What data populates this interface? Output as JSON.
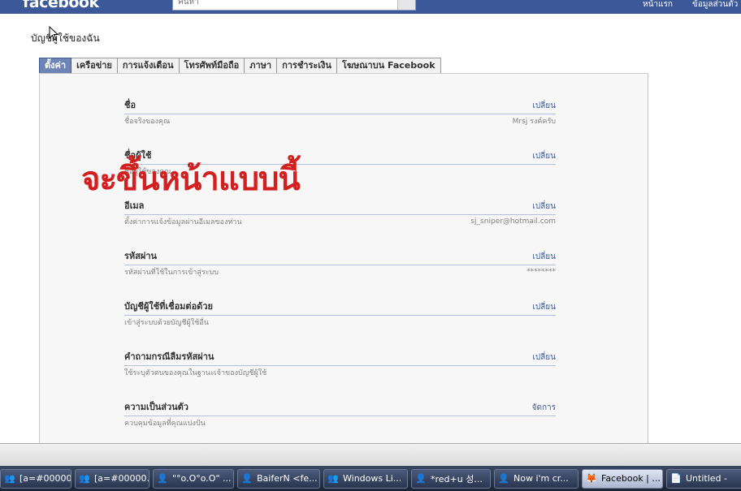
{
  "topbar": {
    "logo": "facebook",
    "search_placeholder": "ค้นหา",
    "links": [
      "หน้าแรก",
      "ข้อมูลส่วนตัว"
    ]
  },
  "page": {
    "title": "บัญชีผู้ใช้ของฉัน"
  },
  "tabs": [
    {
      "label": "ตั้งค่า",
      "active": true
    },
    {
      "label": "เครือข่าย",
      "active": false
    },
    {
      "label": "การแจ้งเตือน",
      "active": false
    },
    {
      "label": "โทรศัพท์มือถือ",
      "active": false
    },
    {
      "label": "ภาษา",
      "active": false
    },
    {
      "label": "การชำระเงิน",
      "active": false
    },
    {
      "label": "โฆษณาบน Facebook",
      "active": false
    }
  ],
  "settings": [
    {
      "label": "ชื่อ",
      "action": "เปลี่ยน",
      "desc": "ชื่อจริงของคุณ",
      "value": "Mrsj รงค์ครับ"
    },
    {
      "label": "ชื่อผู้ใช้",
      "action": "เปลี่ยน",
      "desc": "ชื่อผู้ใช้ของคุณ",
      "value": ""
    },
    {
      "label": "อีเมล",
      "action": "เปลี่ยน",
      "desc": "ตั้งค่าการแจ้งข้อมูลผ่านอีเมลของท่าน",
      "value": "sj_sniper@hotmail.com"
    },
    {
      "label": "รหัสผ่าน",
      "action": "เปลี่ยน",
      "desc": "รหัสผ่านที่ใช้ในการเข้าสู่ระบบ",
      "value": "********"
    },
    {
      "label": "บัญชีผู้ใช้ที่เชื่อมต่อด้วย",
      "action": "เปลี่ยน",
      "desc": "เข้าสู่ระบบด้วยบัญชีผู้ใช้อื่น",
      "value": ""
    },
    {
      "label": "คำถามกรณีลืมรหัสผ่าน",
      "action": "เปลี่ยน",
      "desc": "ใช้ระบุตัวตนของคุณในฐานะเจ้าของบัญชีผู้ใช้",
      "value": ""
    },
    {
      "label": "ความเป็นส่วนตัว",
      "action": "จัดการ",
      "desc": "ควบคุมข้อมูลที่คุณแบ่งปัน",
      "value": ""
    }
  ],
  "overlay_text": "จะขึ้นหน้าแบบนี้",
  "taskbar": [
    {
      "label": "[a=#000000...",
      "icon": "network-icon"
    },
    {
      "label": "[a=#00000...",
      "icon": "people-icon"
    },
    {
      "label": "\"°o.O°o.O\" ...",
      "icon": "messenger-icon"
    },
    {
      "label": "BaiferN <fe...",
      "icon": "messenger-icon"
    },
    {
      "label": "Windows Li...",
      "icon": "people-icon"
    },
    {
      "label": "*red+u 성...",
      "icon": "messenger-icon"
    },
    {
      "label": "Now i'm cr...",
      "icon": "messenger-icon"
    },
    {
      "label": "Facebook | ...",
      "icon": "firefox-icon",
      "active": true
    },
    {
      "label": "Untitled -",
      "icon": "notepad-icon"
    }
  ],
  "colors": {
    "brand": "#3b5998",
    "overlay": "#d21f1f",
    "link": "#3b5998"
  }
}
